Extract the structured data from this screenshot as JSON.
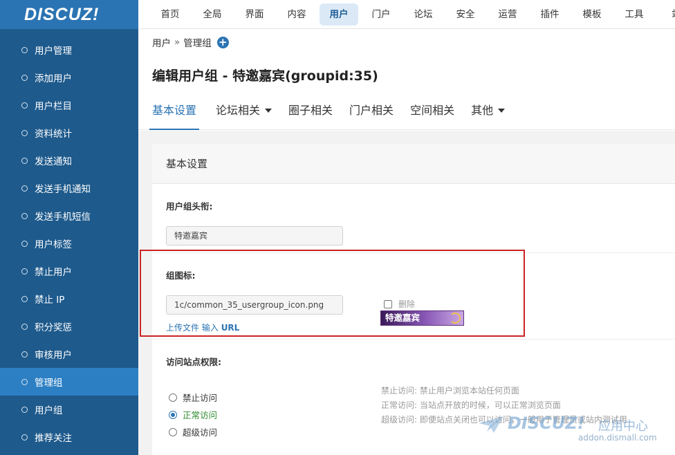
{
  "sidebar": {
    "logo": "DISCUZ!",
    "items": [
      {
        "label": "用户管理"
      },
      {
        "label": "添加用户"
      },
      {
        "label": "用户栏目"
      },
      {
        "label": "资料统计"
      },
      {
        "label": "发送通知"
      },
      {
        "label": "发送手机通知"
      },
      {
        "label": "发送手机短信"
      },
      {
        "label": "用户标签"
      },
      {
        "label": "禁止用户"
      },
      {
        "label": "禁止 IP"
      },
      {
        "label": "积分奖惩"
      },
      {
        "label": "审核用户"
      },
      {
        "label": "管理组",
        "active": true
      },
      {
        "label": "用户组"
      },
      {
        "label": "推荐关注"
      }
    ]
  },
  "topnav": {
    "items": [
      "首页",
      "全局",
      "界面",
      "内容",
      "用户",
      "门户",
      "论坛",
      "安全",
      "运营",
      "插件",
      "模板",
      "工具",
      "站"
    ],
    "active": "用户"
  },
  "breadcrumb": {
    "section": "用户",
    "separator": "»",
    "current": "管理组"
  },
  "page": {
    "title": "编辑用户组 - 特邀嘉宾(groupid:35)"
  },
  "tabs": [
    {
      "label": "基本设置",
      "active": true
    },
    {
      "label": "论坛相关",
      "dropdown": true
    },
    {
      "label": "圈子相关"
    },
    {
      "label": "门户相关"
    },
    {
      "label": "空间相关"
    },
    {
      "label": "其他",
      "dropdown": true
    }
  ],
  "form": {
    "section_title": "基本设置",
    "group_title": {
      "label": "用户组头衔:",
      "value": "特邀嘉宾"
    },
    "group_icon": {
      "label": "组图标:",
      "value": "1c/common_35_usergroup_icon.png",
      "upload_link": "上传文件",
      "url_link_prefix": "输入",
      "url_link": "URL",
      "delete_label": "删除",
      "delete_checked": false,
      "badge_text": "特邀嘉宾"
    },
    "access": {
      "label": "访问站点权限:",
      "options": [
        {
          "label": "禁止访问",
          "checked": false
        },
        {
          "label": "正常访问",
          "checked": true
        },
        {
          "label": "超级访问",
          "checked": false
        }
      ],
      "help": [
        "禁止访问: 禁止用户浏览本站任何页面",
        "正常访问: 当站点开放的时候，可以正常浏览页面",
        "超级访问: 即便站点关闭也可以访问，一般用于管理员或站内测试用"
      ]
    }
  },
  "watermark": {
    "logo": "DISCUZ!",
    "suffix": "应用中心",
    "domain": "addon.dismall.com"
  },
  "colors": {
    "sidebar": "#1e5a8c",
    "accent": "#2b74b3",
    "highlight_border": "#cc2222",
    "nav_active_bg": "#dbe9f7"
  }
}
